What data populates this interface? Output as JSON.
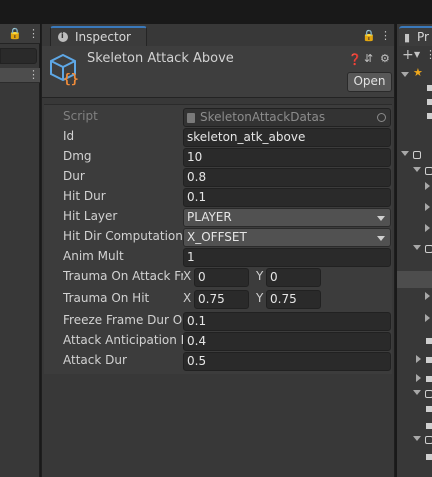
{
  "inspector": {
    "tab_label": "Inspector",
    "title": "Skeleton Attack Above",
    "open_label": "Open",
    "fields": {
      "script": {
        "label": "Script",
        "value": "SkeletonAttackDatas"
      },
      "id": {
        "label": "Id",
        "value": "skeleton_atk_above"
      },
      "dmg": {
        "label": "Dmg",
        "value": "10"
      },
      "dur": {
        "label": "Dur",
        "value": "0.8"
      },
      "hit_dur": {
        "label": "Hit Dur",
        "value": "0.1"
      },
      "hit_layer": {
        "label": "Hit Layer",
        "value": "PLAYER"
      },
      "hit_dir": {
        "label": "Hit Dir Computation T",
        "value": "X_OFFSET"
      },
      "anim_mult": {
        "label": "Anim Mult",
        "value": "1"
      },
      "trauma_attack": {
        "label": "Trauma On Attack Fra",
        "x_label": "X",
        "x": "0",
        "y_label": "Y",
        "y": "0"
      },
      "trauma_hit": {
        "label": "Trauma On Hit",
        "x_label": "X",
        "x": "0.75",
        "y_label": "Y",
        "y": "0.75"
      },
      "freeze": {
        "label": "Freeze Frame Dur On",
        "value": "0.1"
      },
      "anticipation": {
        "label": "Attack Anticipation D",
        "value": "0.4"
      },
      "attack_dur": {
        "label": "Attack Dur",
        "value": "0.5"
      }
    }
  },
  "right_panel": {
    "tab_label": "Pr"
  },
  "colors": {
    "accent": "#3a79bb",
    "background": "#383838",
    "field": "#2a2a2a",
    "asset_icon_blue": "#5ea7e5",
    "asset_icon_orange": "#f08c3a",
    "star": "#f0a81b"
  }
}
